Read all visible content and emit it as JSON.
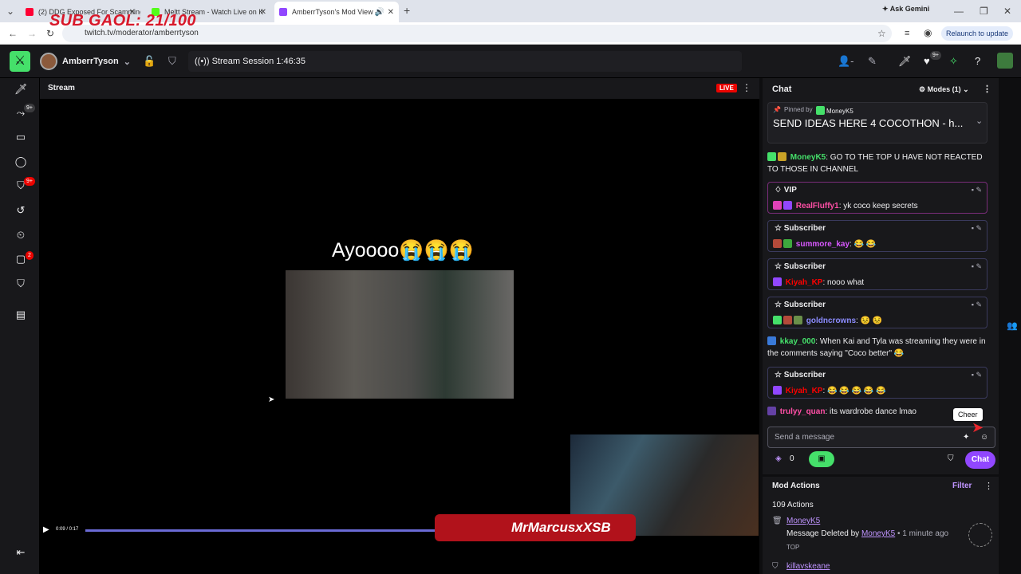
{
  "overlay": {
    "sub_goal": "SUB GAOL: 21/100"
  },
  "browser": {
    "tabs": [
      {
        "title": "(2) DDG Exposed For Scamming",
        "color": "#ff0033"
      },
      {
        "title": "Meltt Stream - Watch Live on K",
        "color": "#53fc18"
      },
      {
        "title": "AmberrTyson's Mod View -",
        "color": "#9147ff"
      }
    ],
    "url": "twitch.tv/moderator/amberrtyson",
    "ask_gemini": "Ask Gemini",
    "relaunch": "Relaunch to update"
  },
  "topbar": {
    "channel_name": "AmberrTyson",
    "session": "Stream Session 1:46:35",
    "notif_count": "9+"
  },
  "leftnav": {
    "badge_1": "9+",
    "badge_2": "9+",
    "badge_3": "2"
  },
  "stream": {
    "title": "Stream",
    "live": "LIVE",
    "caption": "Ayoooo😭😭😭",
    "time": "0:09 / 0:17",
    "watermark": "MrMarcusxXSB"
  },
  "chat": {
    "title": "Chat",
    "modes": "Modes (1)",
    "pinned_by": "Pinned by",
    "pinned_user": "MoneyK5",
    "pinned_text": "SEND IDEAS HERE 4 COCOTHON - h...",
    "messages": [
      {
        "user": "MoneyK5",
        "color": "#45e06a",
        "text": ": GO TO THE TOP U HAVE NOT REACTED TO THOSE IN CHANNEL"
      },
      {
        "label": "VIP",
        "user": "RealFluffy1",
        "color": "#ff4fa6",
        "text": ": yk coco keep secrets"
      },
      {
        "label": "Subscriber",
        "user": "summore_kay",
        "color": "#d958ff",
        "text": ": 😂 😂"
      },
      {
        "label": "Subscriber",
        "user": "Kiyah_KP",
        "color": "#ff0000",
        "text": ": nooo what"
      },
      {
        "label": "Subscriber",
        "user": "goldncrowns",
        "color": "#8c8cff",
        "text": ": 😣 😣"
      },
      {
        "user": "kkay_000",
        "color": "#45e06a",
        "text": ": When Kai and Tyla was streaming they were in the comments saying \"Coco better\" 😂"
      },
      {
        "label": "Subscriber",
        "user": "Kiyah_KP",
        "color": "#ff0000",
        "text": ": 😂 😂 😂 😂 😂"
      },
      {
        "user": "trulyy_quan",
        "color": "#ff4fa6",
        "text": ": its wardrobe dance lmao"
      }
    ],
    "send_placeholder": "Send a message",
    "cheer_tooltip": "Cheer",
    "points": "0",
    "chat_button": "Chat"
  },
  "mod_actions": {
    "title": "Mod Actions",
    "filter": "Filter",
    "count": "109 Actions",
    "entries": [
      {
        "user": "MoneyK5",
        "action_prefix": "Message Deleted by",
        "actor": "MoneyK5",
        "time": "• 1 minute ago",
        "detail": "TOP"
      },
      {
        "user": "killavskeane"
      }
    ]
  }
}
